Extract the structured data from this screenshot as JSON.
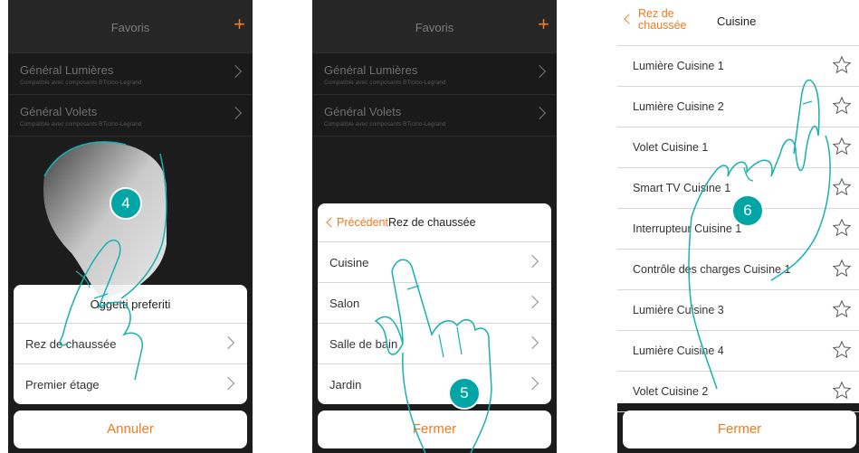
{
  "panel1": {
    "header_title": "Favoris",
    "plus_label": "+",
    "favorites": [
      {
        "title": "Général Lumières",
        "subtitle": "Compatible avec composants BTicino-Legrand"
      },
      {
        "title": "Général Volets",
        "subtitle": "Compatible avec composants BTicino-Legrand"
      }
    ],
    "sheet_title": "Oggetti preferiti",
    "rows": [
      "Rez de chaussée",
      "Premier étage"
    ],
    "cancel_label": "Annuler",
    "step": "4"
  },
  "panel2": {
    "header_title": "Favoris",
    "plus_label": "+",
    "favorites": [
      {
        "title": "Général Lumières",
        "subtitle": "Compatible avec composants BTicino-Legrand"
      },
      {
        "title": "Général Volets",
        "subtitle": "Compatible avec composants BTicino-Legrand"
      }
    ],
    "back_label": "Précédent",
    "sheet_title": "Rez de chaussée",
    "rows": [
      "Cuisine",
      "Salon",
      "Salle de bain",
      "Jardin"
    ],
    "close_label": "Fermer",
    "step": "5"
  },
  "panel3": {
    "back_line1": "Rez de",
    "back_line2": "chaussée",
    "title": "Cuisine",
    "items": [
      "Lumière Cuisine 1",
      "Lumière Cuisine 2",
      "Volet Cuisine 1",
      "Smart TV Cuisine 1",
      "Interrupteur Cuisine 1",
      "Contrôle des charges Cuisine 1",
      "Lumière Cuisine 3",
      "Lumière Cuisine 4",
      "Volet Cuisine 2"
    ],
    "close_label": "Fermer",
    "step": "6"
  },
  "colors": {
    "accent": "#f27a1f",
    "badge": "#00a5a6",
    "dark_bg": "#1c1c1c"
  },
  "icons": [
    "plus-icon",
    "chevron-right-icon",
    "chevron-left-icon",
    "star-outline-icon",
    "pointing-hand-illustration"
  ]
}
